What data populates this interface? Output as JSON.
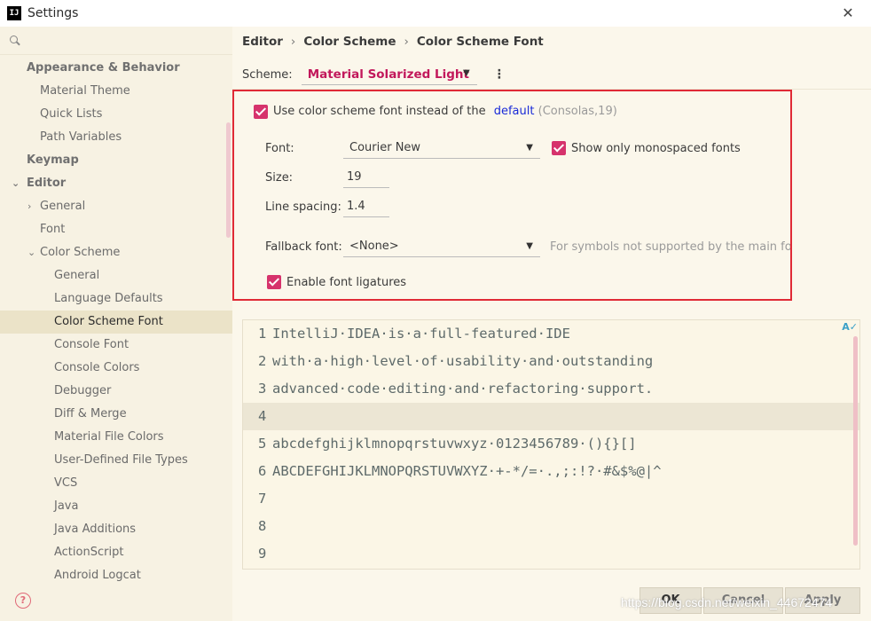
{
  "window": {
    "title": "Settings",
    "logo_text": "IJ",
    "close": "✕"
  },
  "search": {
    "value": "",
    "placeholder": ""
  },
  "sidebar": {
    "items": [
      {
        "label": "Appearance & Behavior"
      },
      {
        "label": "Material Theme"
      },
      {
        "label": "Quick Lists"
      },
      {
        "label": "Path Variables"
      },
      {
        "label": "Keymap"
      },
      {
        "label": "Editor"
      },
      {
        "label": "General"
      },
      {
        "label": "Font"
      },
      {
        "label": "Color Scheme"
      },
      {
        "label": "General"
      },
      {
        "label": "Language Defaults"
      },
      {
        "label": "Color Scheme Font"
      },
      {
        "label": "Console Font"
      },
      {
        "label": "Console Colors"
      },
      {
        "label": "Debugger"
      },
      {
        "label": "Diff & Merge"
      },
      {
        "label": "Material File Colors"
      },
      {
        "label": "User-Defined File Types"
      },
      {
        "label": "VCS"
      },
      {
        "label": "Java"
      },
      {
        "label": "Java Additions"
      },
      {
        "label": "ActionScript"
      },
      {
        "label": "Android Logcat"
      }
    ],
    "help": "?"
  },
  "breadcrumb": [
    "Editor",
    "Color Scheme",
    "Color Scheme Font"
  ],
  "breadcrumb_sep": "›",
  "scheme": {
    "label": "Scheme:",
    "value": "Material Solarized Light",
    "more": "⋮"
  },
  "font_settings": {
    "use_scheme_font_label": "Use color scheme font instead of the",
    "default_link": "default",
    "default_hint": "(Consolas,19)",
    "font_label": "Font:",
    "font_value": "Courier New",
    "mono_only_label": "Show only monospaced fonts",
    "size_label": "Size:",
    "size_value": "19",
    "line_spacing_label": "Line spacing:",
    "line_spacing_value": "1.4",
    "fallback_label": "Fallback font:",
    "fallback_value": "<None>",
    "fallback_hint": "For symbols not supported by the main font",
    "ligatures_label": "Enable font ligatures"
  },
  "preview": {
    "lines": [
      {
        "num": "1",
        "text": "IntelliJ·IDEA·is·a·full-featured·IDE"
      },
      {
        "num": "2",
        "text": "with·a·high·level·of·usability·and·outstanding"
      },
      {
        "num": "3",
        "text": "advanced·code·editing·and·refactoring·support."
      },
      {
        "num": "4",
        "text": ""
      },
      {
        "num": "5",
        "text": "abcdefghijklmnopqrstuvwxyz·0123456789·(){}[]"
      },
      {
        "num": "6",
        "text": "ABCDEFGHIJKLMNOPQRSTUVWXYZ·+-*/=·.,;:!?·#&$%@|^"
      },
      {
        "num": "7",
        "text": ""
      },
      {
        "num": "8",
        "text": ""
      },
      {
        "num": "9",
        "text": ""
      }
    ],
    "current_line": 4
  },
  "buttons": {
    "ok": "OK",
    "cancel": "Cancel",
    "apply": "Apply"
  },
  "watermark": "https://blog.csdn.net/weixin_44672474",
  "colors": {
    "accent": "#d6336c",
    "scheme_name": "#c2185b",
    "highlight_border": "#e02a36",
    "link": "#1a2bd8",
    "background": "#fbf7eb"
  },
  "icons": {
    "search": "search-icon",
    "close": "close-icon",
    "help": "help-icon",
    "spellcheck": "spellcheck-icon"
  }
}
